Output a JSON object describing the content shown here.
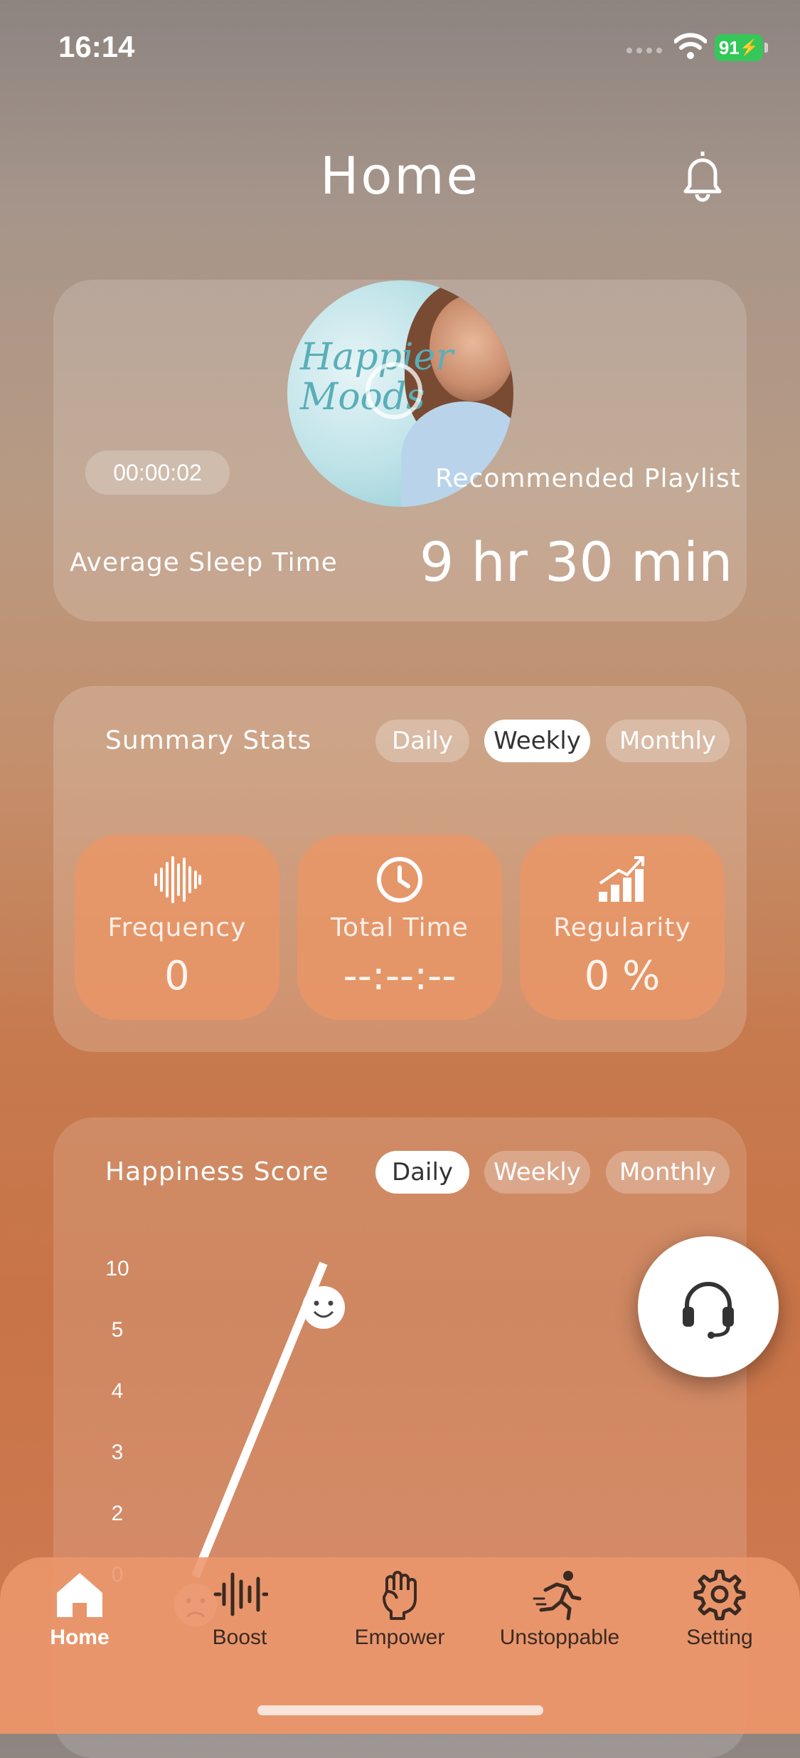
{
  "status_bar": {
    "time": "16:14",
    "battery": "91"
  },
  "header": {
    "title": "Home"
  },
  "sleep_card": {
    "timer": "00:00:02",
    "playlist_label": "Recommended Playlist",
    "cover_text_line1": "Happier",
    "cover_text_line2": "Moods",
    "avg_label": "Average Sleep Time",
    "avg_value": "9 hr 30 min"
  },
  "summary": {
    "title": "Summary Stats",
    "tabs": [
      {
        "label": "Daily",
        "active": false
      },
      {
        "label": "Weekly",
        "active": true
      },
      {
        "label": "Monthly",
        "active": false
      }
    ],
    "stats": [
      {
        "label": "Frequency",
        "value": "0",
        "icon": "soundwave-icon"
      },
      {
        "label": "Total Time",
        "value": "--:--:--",
        "icon": "clock-icon"
      },
      {
        "label": "Regularity",
        "value": "0 %",
        "icon": "signal-bars-icon"
      }
    ]
  },
  "happiness": {
    "title": "Happiness Score",
    "tabs": [
      {
        "label": "Daily",
        "active": true
      },
      {
        "label": "Weekly",
        "active": false
      },
      {
        "label": "Monthly",
        "active": false
      }
    ]
  },
  "chart_data": {
    "type": "line",
    "title": "Happiness Score",
    "y_tick_labels": [
      "10",
      "5",
      "4",
      "3",
      "2",
      "0"
    ],
    "series": [
      {
        "points": [
          {
            "x": 0,
            "y": 0
          },
          {
            "x": 1,
            "y": 10
          }
        ]
      }
    ],
    "markers": [
      "sad-face-icon",
      "smiley-face-icon"
    ],
    "grid": false
  },
  "tabbar": {
    "items": [
      {
        "label": "Home",
        "icon": "home-icon",
        "active": true
      },
      {
        "label": "Boost",
        "icon": "soundwave-icon",
        "active": false
      },
      {
        "label": "Empower",
        "icon": "raised-fist-icon",
        "active": false
      },
      {
        "label": "Unstoppable",
        "icon": "runner-icon",
        "active": false
      },
      {
        "label": "Setting",
        "icon": "gear-icon",
        "active": false
      }
    ]
  }
}
